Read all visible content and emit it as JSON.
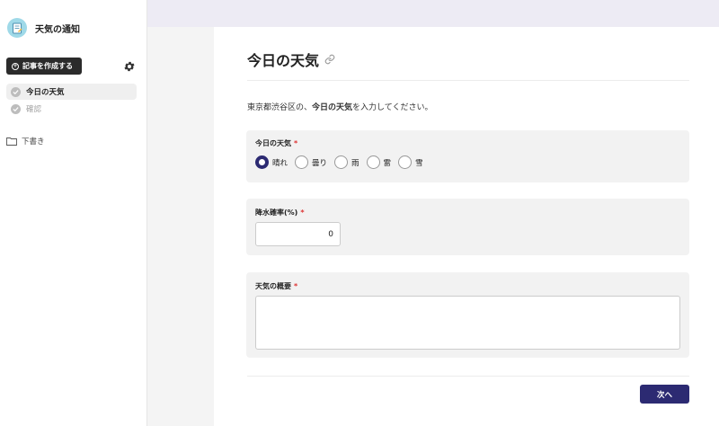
{
  "app": {
    "title": "天気の通知"
  },
  "sidebar": {
    "create_label": "記事を作成する",
    "steps": [
      {
        "label": "今日の天気",
        "state": "active"
      },
      {
        "label": "確認",
        "state": "inactive"
      }
    ],
    "drafts_label": "下書き"
  },
  "main": {
    "title": "今日の天気",
    "intro_before": "東京都渋谷区の、",
    "intro_bold": "今日の天気",
    "intro_after": "を入力してください。",
    "weather": {
      "label": "今日の天気",
      "required_mark": "*",
      "options": [
        "晴れ",
        "曇り",
        "雨",
        "雷",
        "雪"
      ],
      "selected": "晴れ"
    },
    "precip": {
      "label": "降水確率(%)",
      "required_mark": "*",
      "value": "0"
    },
    "summary": {
      "label": "天気の概要",
      "required_mark": "*",
      "value": ""
    },
    "next_label": "次へ"
  },
  "colors": {
    "accent": "#2c2a72",
    "topbar": "#edebf4",
    "card": "#f2f2f2",
    "required": "#dd3333"
  },
  "icons": {
    "logo": "notepad-icon",
    "gear": "gear-icon",
    "check": "check-circle-icon",
    "folder": "folder-icon",
    "link": "link-icon"
  }
}
